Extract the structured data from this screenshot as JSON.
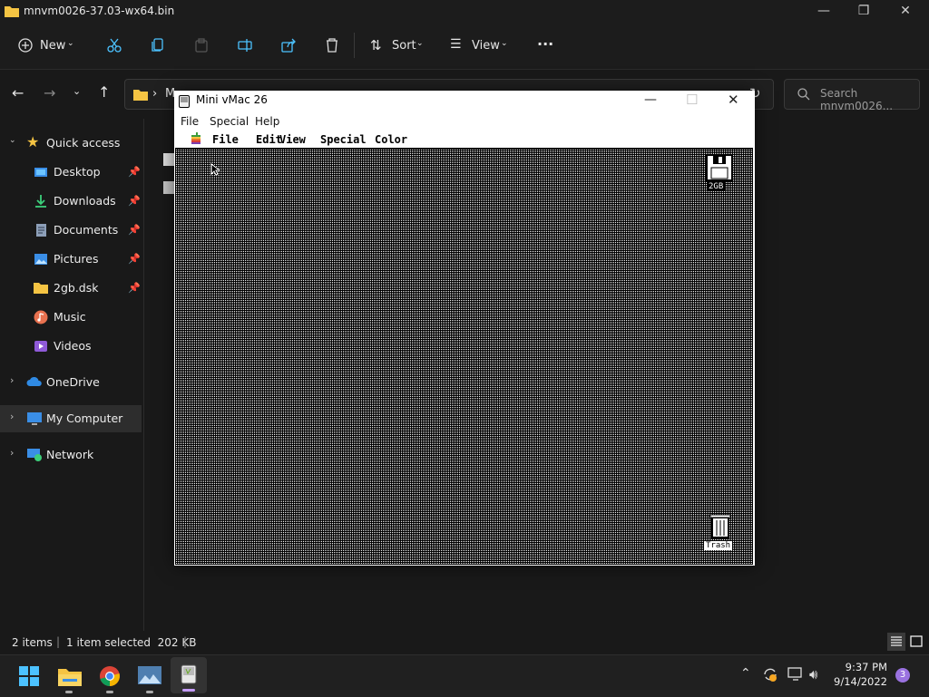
{
  "explorer": {
    "title": "mnvm0026-37.03-wx64.bin",
    "toolbar": {
      "new_label": "New",
      "sort_label": "Sort",
      "view_label": "View",
      "more_label": "···"
    },
    "address": {
      "path_first_letter": "M",
      "search_placeholder": "Search mnvm0026..."
    },
    "nav": {
      "quick_access": "Quick access",
      "items": [
        {
          "label": "Desktop",
          "icon": "desktop-icon",
          "pinned": true
        },
        {
          "label": "Downloads",
          "icon": "download-icon",
          "pinned": true
        },
        {
          "label": "Documents",
          "icon": "document-icon",
          "pinned": true
        },
        {
          "label": "Pictures",
          "icon": "pictures-icon",
          "pinned": true
        },
        {
          "label": "2gb.dsk",
          "icon": "folder-icon",
          "pinned": true
        },
        {
          "label": "Music",
          "icon": "music-icon",
          "pinned": false
        },
        {
          "label": "Videos",
          "icon": "videos-icon",
          "pinned": false
        }
      ],
      "onedrive": "OneDrive",
      "my_computer": "My Computer",
      "network": "Network"
    },
    "status": {
      "items": "2 items",
      "selection": "1 item selected  202 KB"
    }
  },
  "vmac": {
    "title": "Mini vMac 26",
    "menu": [
      "File",
      "Special",
      "Help"
    ],
    "mac_menu": [
      "File",
      "Edit",
      "View",
      "Special",
      "Color"
    ],
    "disk_label": "2GB",
    "trash_label": "Trash"
  },
  "taskbar": {
    "time": "9:37 PM",
    "date": "9/14/2022",
    "notification_count": "3"
  },
  "colors": {
    "accent": "#4cc2ff",
    "folder": "#f5c443",
    "badge": "#9a72e0"
  }
}
